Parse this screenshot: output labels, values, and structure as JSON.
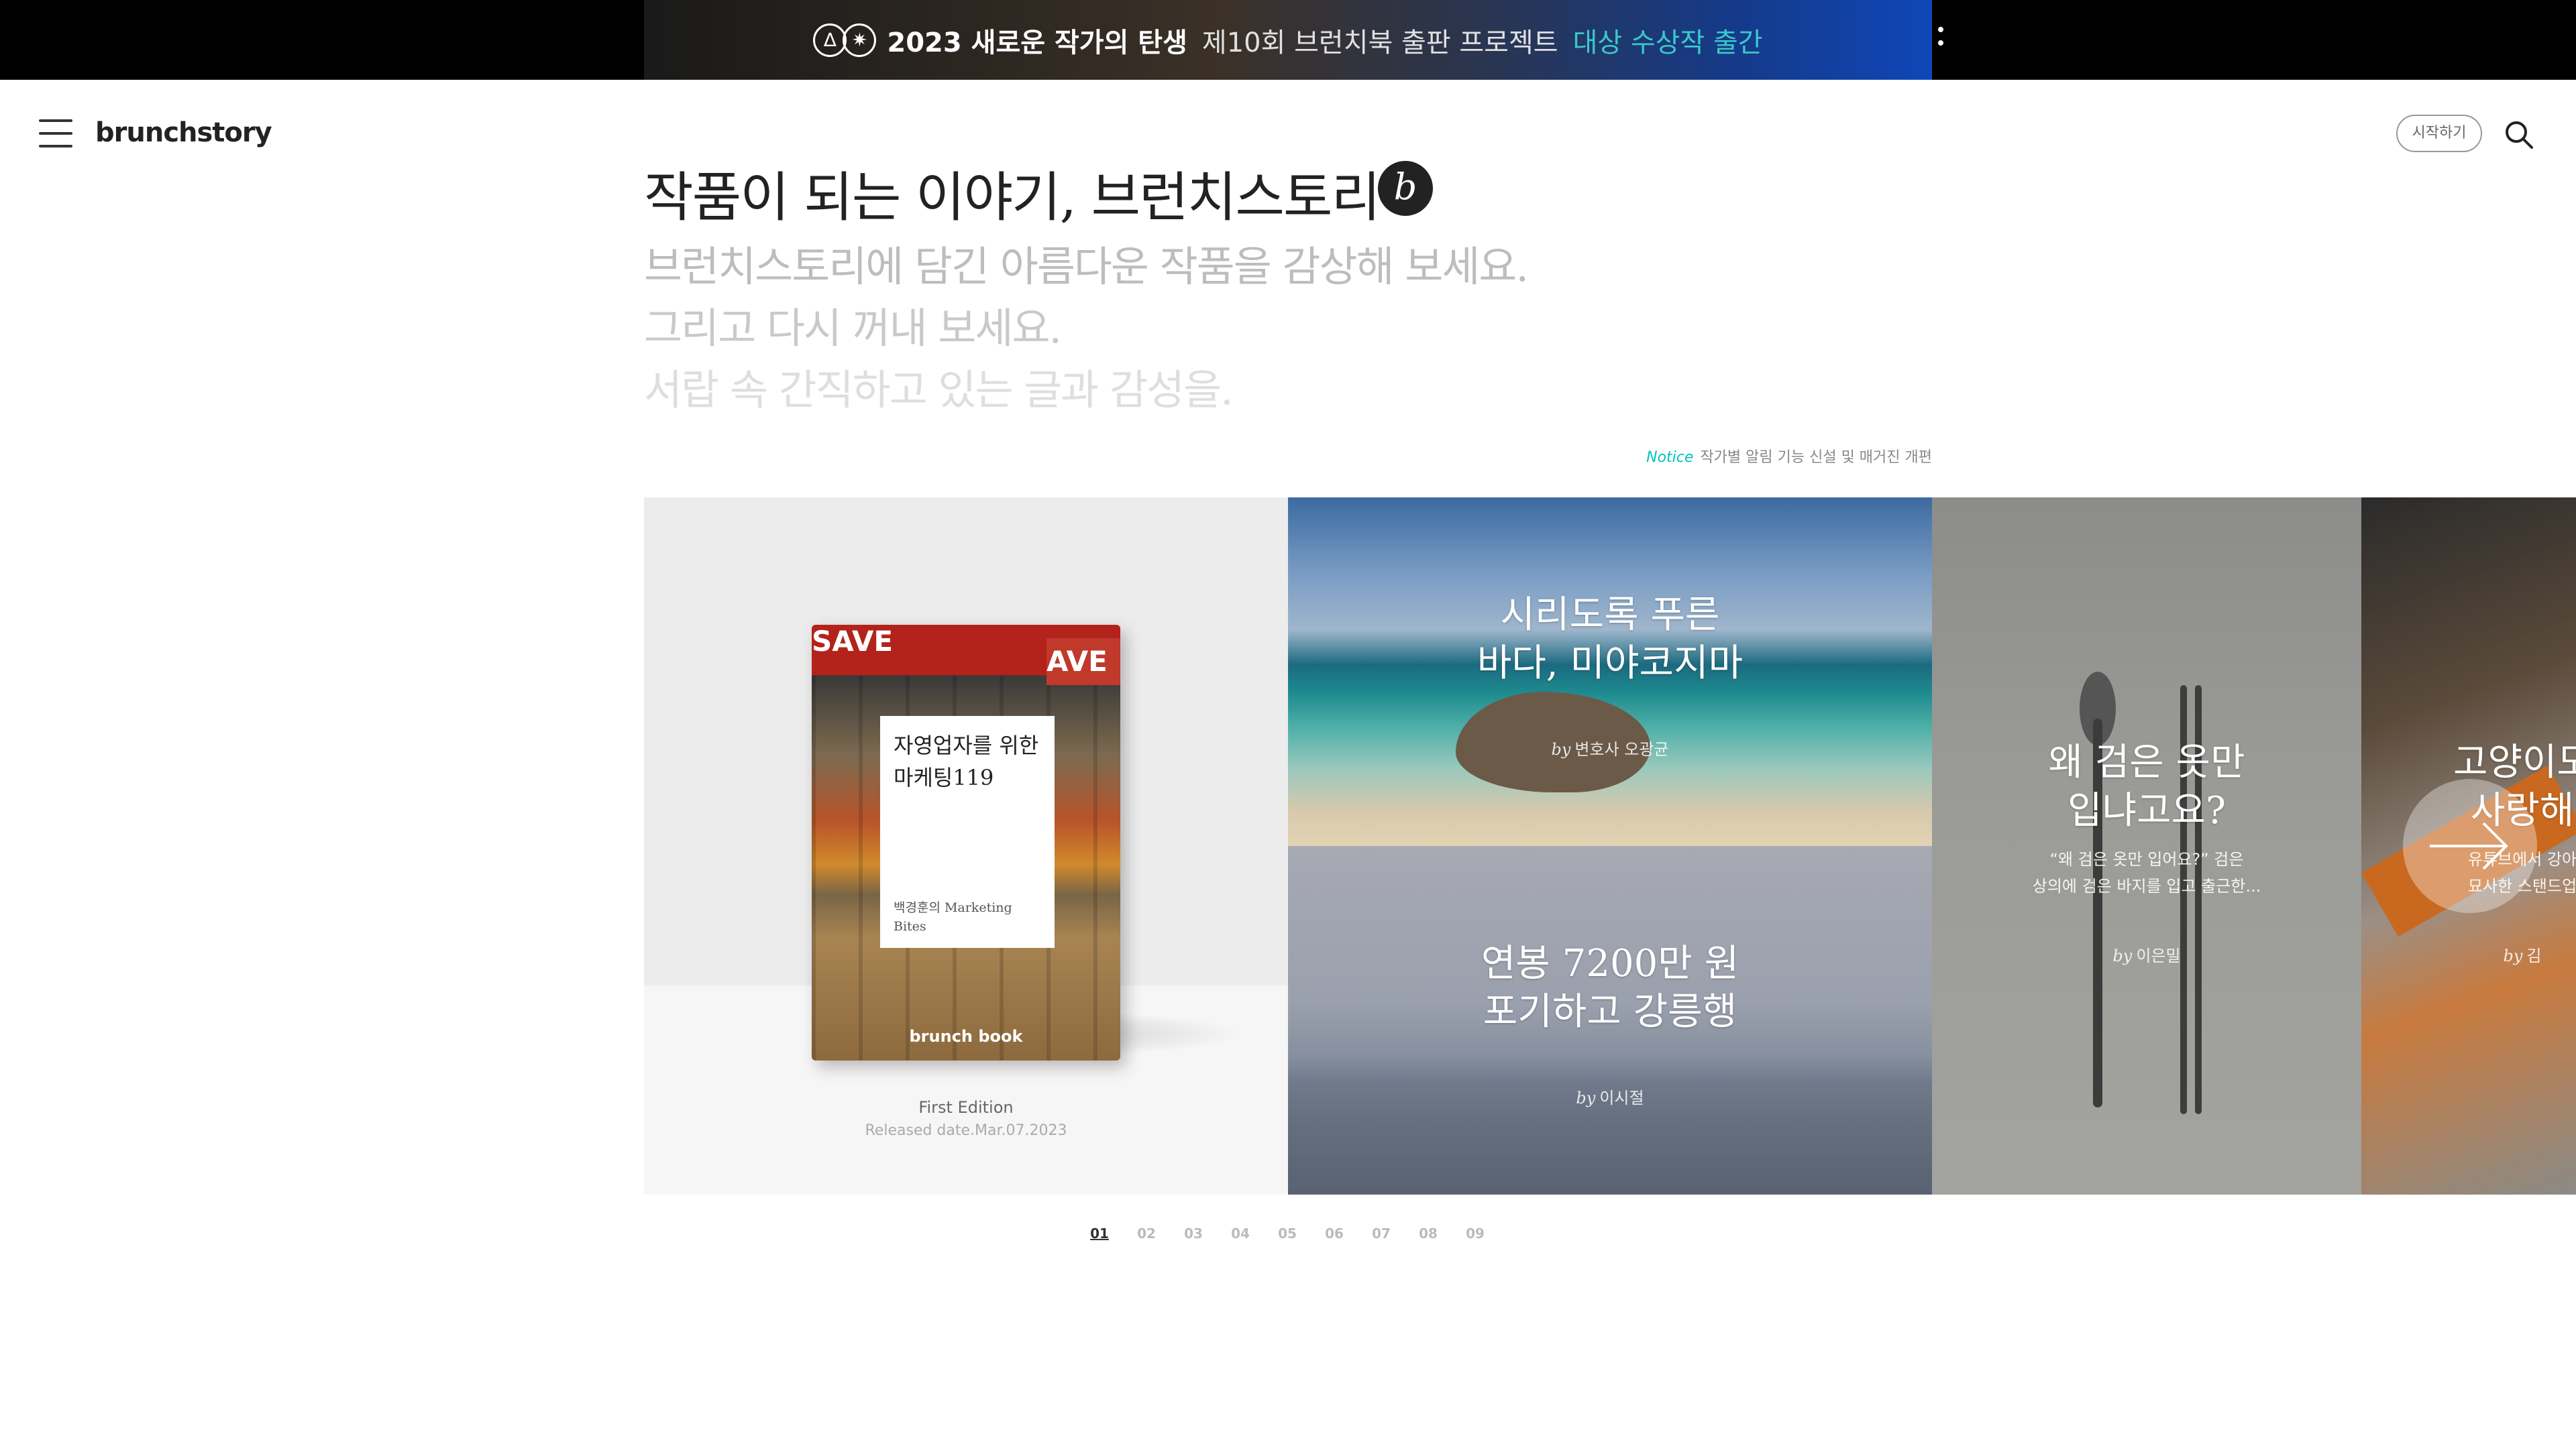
{
  "banner": {
    "logo_glyphs": [
      "∆",
      "✷"
    ],
    "strong_text": "2023 새로운 작가의 탄생",
    "light_text": "제10회 브런치북 출판 프로젝트",
    "accent_text": "대상 수상작 출간",
    "accent_color": "#3bc8c8"
  },
  "header": {
    "logo": "brunchstory",
    "start_label": "시작하기",
    "menu_icon": "hamburger-icon",
    "search_icon": "search-icon"
  },
  "intro": {
    "headline": "작품이 되는 이야기, 브런치스토리",
    "badge": "b",
    "lines": [
      "브런치스토리에 담긴 아름다운 작품을 감상해 보세요.",
      "그리고 다시 꺼내 보세요.",
      "서랍 속 간직하고 있는 글과 감성을."
    ]
  },
  "notice": {
    "label": "Notice",
    "text": "작가별 알림 기능 신설 및 매거진 개편",
    "label_color": "#00c3bd"
  },
  "featured_book": {
    "sign_left": "SAVE",
    "sign_right": "AVE",
    "title": "자영업자를 위한 마케팅119",
    "author": "백경훈의 Marketing Bites",
    "brand": "brunch book",
    "edition": "First Edition",
    "release": "Released date.Mar.07.2023"
  },
  "panels": [
    {
      "title": "시리도록 푸른\n바다, 미야코지마",
      "by": "by",
      "author": "변호사 오광균"
    },
    {
      "title": "연봉 7200만 원\n포기하고 강릉행",
      "by": "by",
      "author": "이시절"
    },
    {
      "title": "왜 검은 옷만\n입냐고요?",
      "desc": "“왜 검은 옷만 입어요?” 검은\n상의에 검은 바지를 입고 출근한...",
      "by": "by",
      "author": "이은밀"
    },
    {
      "title": "고양이도\n사랑해",
      "desc": "유튜브에서 강아\n묘사한 스탠드업",
      "by": "by",
      "author": "김"
    }
  ],
  "next_icon": "arrow-right-icon",
  "pagination": {
    "pages": [
      "01",
      "02",
      "03",
      "04",
      "05",
      "06",
      "07",
      "08",
      "09"
    ],
    "active": "01"
  }
}
